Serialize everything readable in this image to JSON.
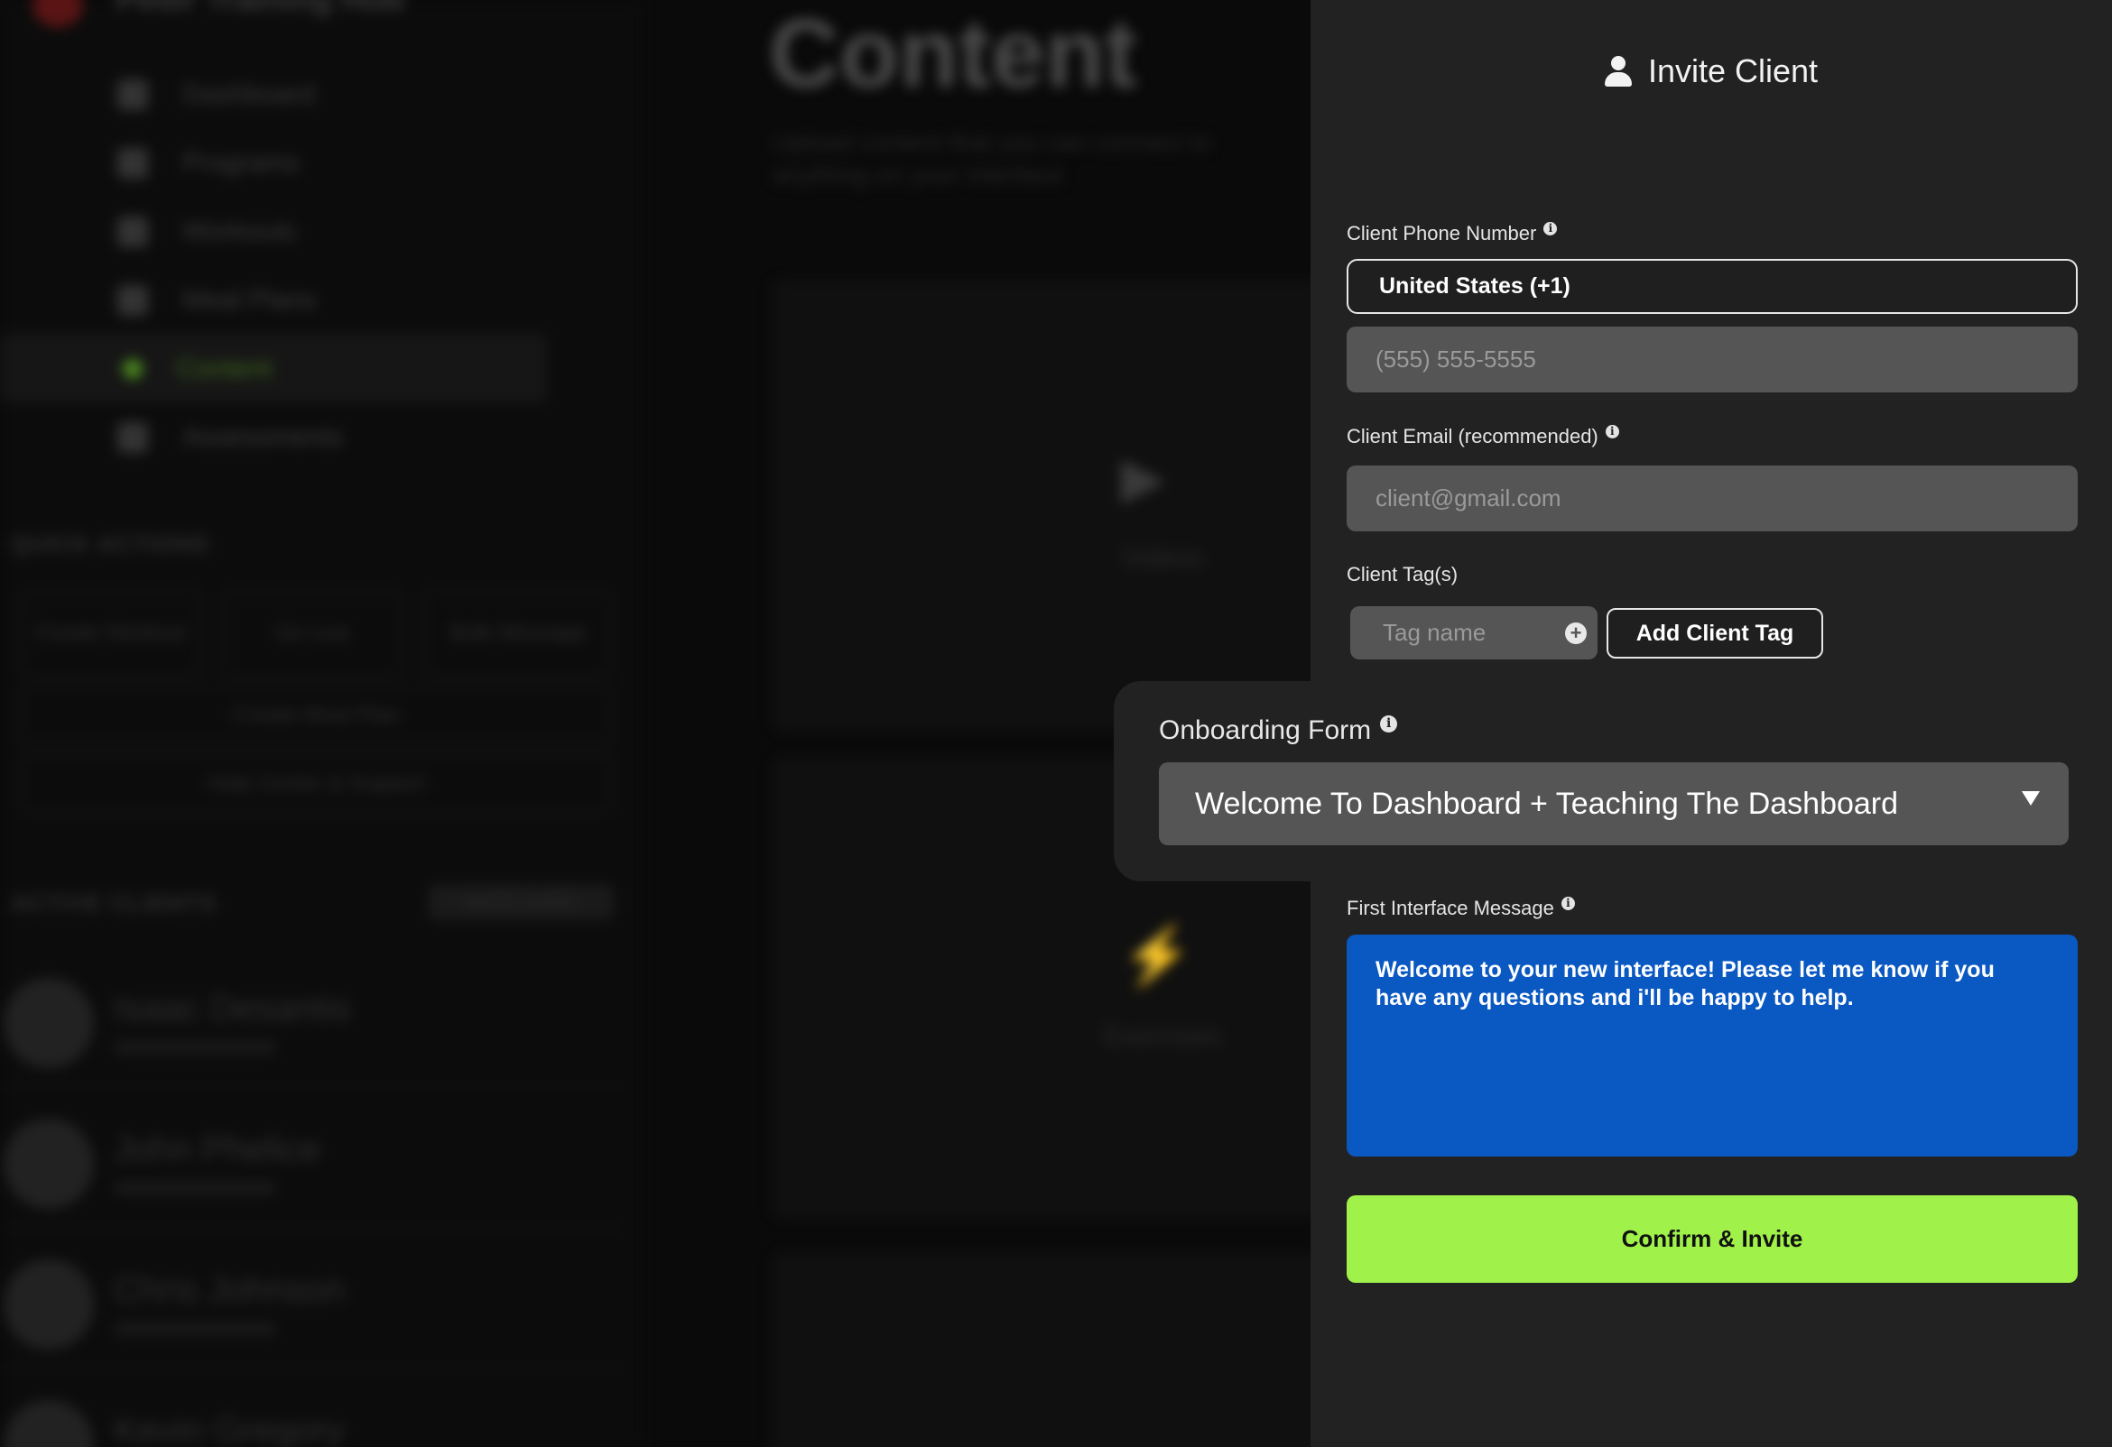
{
  "background": {
    "brand": "Peter Training Hub",
    "nav_items": [
      "Dashboard",
      "Programs",
      "Workouts",
      "Meal Plans",
      "Content",
      "Assessments"
    ],
    "active_nav_index": 4,
    "quick_actions_title": "QUICK ACTIONS",
    "quick_actions": [
      "Create Workout",
      "Go Live",
      "Bulk Message"
    ],
    "create_meal_plan": "Create Meal Plan",
    "help": "Help Center & Support",
    "active_clients_title": "ACTIVE CLIENTS",
    "invite_client_small": "INVITE CLIENT",
    "clients": [
      "Isaac Desantis",
      "John Phelice",
      "Chris Johnson",
      "Kevin Gregory"
    ],
    "page_title": "Content",
    "page_subtitle": "Upload content that you can connect to anything on your interface",
    "cards": [
      "Videos",
      "Exercises"
    ]
  },
  "drawer": {
    "title": "Invite Client",
    "phone_label": "Client Phone Number",
    "country_value": "United States (+1)",
    "phone_placeholder": "(555) 555-5555",
    "email_label": "Client Email (recommended)",
    "email_placeholder": "client@gmail.com",
    "tags_label": "Client Tag(s)",
    "tag_placeholder": "Tag name",
    "add_tag_label": "Add Client Tag",
    "onboarding_label": "Onboarding Form",
    "onboarding_value": "Welcome To Dashboard + Teaching The Dashboard",
    "message_label": "First Interface Message",
    "message_value": "Welcome to your new interface! Please let me know if you have any questions and i'll be happy to help.",
    "confirm_label": "Confirm & Invite"
  },
  "colors": {
    "drawer_bg": "#222222",
    "input_bg": "#555555",
    "message_bg": "#0a58c2",
    "confirm_bg": "#a0f24a"
  }
}
